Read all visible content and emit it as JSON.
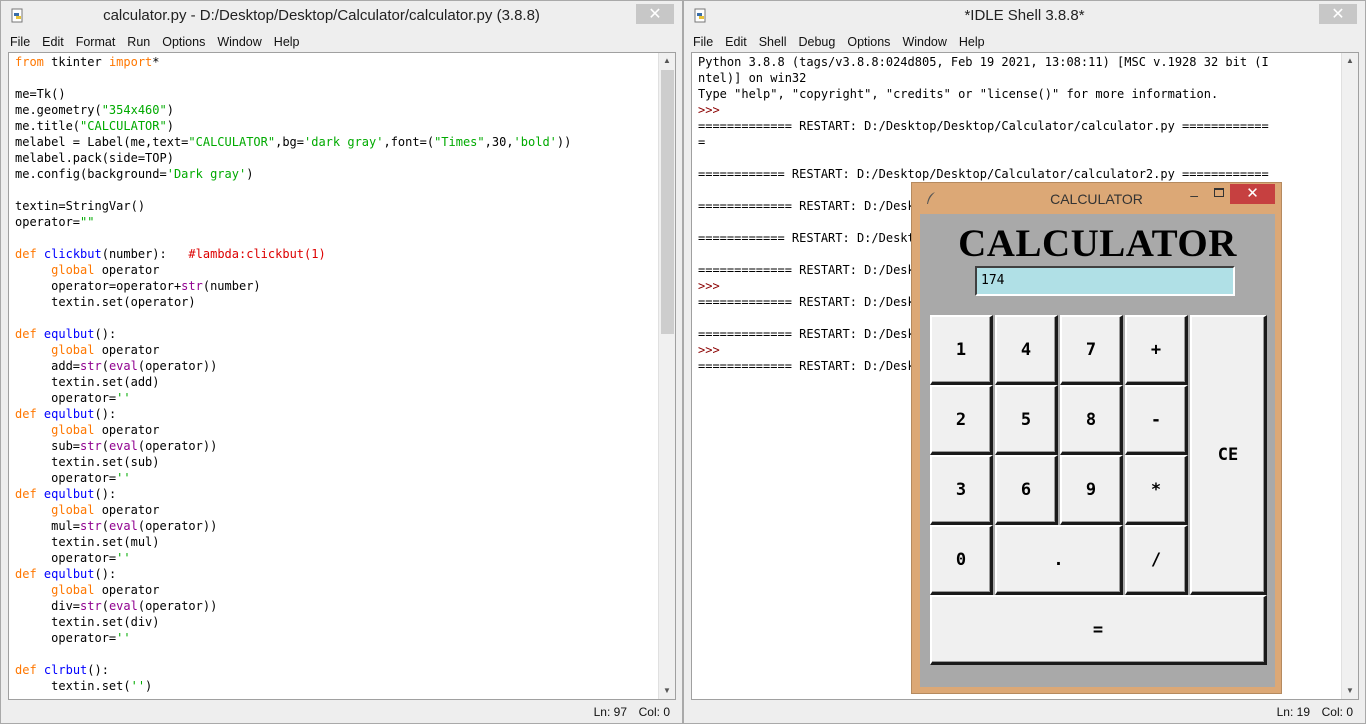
{
  "editor": {
    "title": "calculator.py - D:/Desktop/Desktop/Calculator/calculator.py (3.8.8)",
    "menu": [
      "File",
      "Edit",
      "Format",
      "Run",
      "Options",
      "Window",
      "Help"
    ],
    "status": {
      "line": "Ln: 97",
      "col": "Col: 0"
    },
    "code_lines": [
      [
        [
          "kw",
          "from"
        ],
        [
          "n",
          " tkinter "
        ],
        [
          "kw",
          "import"
        ],
        [
          "n",
          "*"
        ]
      ],
      [
        [
          "n",
          ""
        ]
      ],
      [
        [
          "n",
          "me=Tk()"
        ]
      ],
      [
        [
          "n",
          "me.geometry("
        ],
        [
          "str",
          "\"354x460\""
        ],
        [
          "n",
          ")"
        ]
      ],
      [
        [
          "n",
          "me.title("
        ],
        [
          "str",
          "\"CALCULATOR\""
        ],
        [
          "n",
          ")"
        ]
      ],
      [
        [
          "n",
          "melabel = Label(me,text="
        ],
        [
          "str",
          "\"CALCULATOR\""
        ],
        [
          "n",
          ",bg="
        ],
        [
          "str",
          "'dark gray'"
        ],
        [
          "n",
          ",font=("
        ],
        [
          "str",
          "\"Times\""
        ],
        [
          "n",
          ",30,"
        ],
        [
          "str",
          "'bold'"
        ],
        [
          "n",
          "))"
        ]
      ],
      [
        [
          "n",
          "melabel.pack(side=TOP)"
        ]
      ],
      [
        [
          "n",
          "me.config(background="
        ],
        [
          "str",
          "'Dark gray'"
        ],
        [
          "n",
          ")"
        ]
      ],
      [
        [
          "n",
          ""
        ]
      ],
      [
        [
          "n",
          "textin=StringVar()"
        ]
      ],
      [
        [
          "n",
          "operator="
        ],
        [
          "str",
          "\"\""
        ]
      ],
      [
        [
          "n",
          ""
        ]
      ],
      [
        [
          "kw",
          "def"
        ],
        [
          "n",
          " "
        ],
        [
          "def",
          "clickbut"
        ],
        [
          "n",
          "(number):   "
        ],
        [
          "cmt",
          "#lambda:clickbut(1)"
        ]
      ],
      [
        [
          "n",
          "     "
        ],
        [
          "kw",
          "global"
        ],
        [
          "n",
          " operator"
        ]
      ],
      [
        [
          "n",
          "     operator=operator+"
        ],
        [
          "bi",
          "str"
        ],
        [
          "n",
          "(number)"
        ]
      ],
      [
        [
          "n",
          "     textin.set(operator)"
        ]
      ],
      [
        [
          "n",
          ""
        ]
      ],
      [
        [
          "kw",
          "def"
        ],
        [
          "n",
          " "
        ],
        [
          "def",
          "equlbut"
        ],
        [
          "n",
          "():"
        ]
      ],
      [
        [
          "n",
          "     "
        ],
        [
          "kw",
          "global"
        ],
        [
          "n",
          " operator"
        ]
      ],
      [
        [
          "n",
          "     add="
        ],
        [
          "bi",
          "str"
        ],
        [
          "n",
          "("
        ],
        [
          "bi",
          "eval"
        ],
        [
          "n",
          "(operator))"
        ]
      ],
      [
        [
          "n",
          "     textin.set(add)"
        ]
      ],
      [
        [
          "n",
          "     operator="
        ],
        [
          "str",
          "''"
        ]
      ],
      [
        [
          "kw",
          "def"
        ],
        [
          "n",
          " "
        ],
        [
          "def",
          "equlbut"
        ],
        [
          "n",
          "():"
        ]
      ],
      [
        [
          "n",
          "     "
        ],
        [
          "kw",
          "global"
        ],
        [
          "n",
          " operator"
        ]
      ],
      [
        [
          "n",
          "     sub="
        ],
        [
          "bi",
          "str"
        ],
        [
          "n",
          "("
        ],
        [
          "bi",
          "eval"
        ],
        [
          "n",
          "(operator))"
        ]
      ],
      [
        [
          "n",
          "     textin.set(sub)"
        ]
      ],
      [
        [
          "n",
          "     operator="
        ],
        [
          "str",
          "''"
        ]
      ],
      [
        [
          "kw",
          "def"
        ],
        [
          "n",
          " "
        ],
        [
          "def",
          "equlbut"
        ],
        [
          "n",
          "():"
        ]
      ],
      [
        [
          "n",
          "     "
        ],
        [
          "kw",
          "global"
        ],
        [
          "n",
          " operator"
        ]
      ],
      [
        [
          "n",
          "     mul="
        ],
        [
          "bi",
          "str"
        ],
        [
          "n",
          "("
        ],
        [
          "bi",
          "eval"
        ],
        [
          "n",
          "(operator))"
        ]
      ],
      [
        [
          "n",
          "     textin.set(mul)"
        ]
      ],
      [
        [
          "n",
          "     operator="
        ],
        [
          "str",
          "''"
        ]
      ],
      [
        [
          "kw",
          "def"
        ],
        [
          "n",
          " "
        ],
        [
          "def",
          "equlbut"
        ],
        [
          "n",
          "():"
        ]
      ],
      [
        [
          "n",
          "     "
        ],
        [
          "kw",
          "global"
        ],
        [
          "n",
          " operator"
        ]
      ],
      [
        [
          "n",
          "     div="
        ],
        [
          "bi",
          "str"
        ],
        [
          "n",
          "("
        ],
        [
          "bi",
          "eval"
        ],
        [
          "n",
          "(operator))"
        ]
      ],
      [
        [
          "n",
          "     textin.set(div)"
        ]
      ],
      [
        [
          "n",
          "     operator="
        ],
        [
          "str",
          "''"
        ]
      ],
      [
        [
          "n",
          ""
        ]
      ],
      [
        [
          "kw",
          "def"
        ],
        [
          "n",
          " "
        ],
        [
          "def",
          "clrbut"
        ],
        [
          "n",
          "():"
        ]
      ],
      [
        [
          "n",
          "     textin.set("
        ],
        [
          "str",
          "''"
        ],
        [
          "n",
          ")"
        ]
      ]
    ]
  },
  "shell": {
    "title": "*IDLE Shell 3.8.8*",
    "menu": [
      "File",
      "Edit",
      "Shell",
      "Debug",
      "Options",
      "Window",
      "Help"
    ],
    "status": {
      "line": "Ln: 19",
      "col": "Col: 0"
    },
    "lines": [
      [
        [
          "cons",
          "Python 3.8.8 (tags/v3.8.8:024d805, Feb 19 2021, 13:08:11) [MSC v.1928 32 bit (I"
        ]
      ],
      [
        [
          "cons",
          "ntel)] on win32"
        ]
      ],
      [
        [
          "cons",
          "Type \"help\", \"copyright\", \"credits\" or \"license()\" for more information."
        ]
      ],
      [
        [
          "prompt",
          ">>> "
        ]
      ],
      [
        [
          "cons",
          "============= RESTART: D:/Desktop/Desktop/Calculator/calculator.py ============"
        ]
      ],
      [
        [
          "cons",
          "="
        ]
      ],
      [
        [
          "cons",
          ""
        ]
      ],
      [
        [
          "cons",
          "============ RESTART: D:/Desktop/Desktop/Calculator/calculator2.py ============"
        ]
      ],
      [
        [
          "cons",
          ""
        ]
      ],
      [
        [
          "cons",
          "============= RESTART: D:/Desktop/Desktop/Calculator/calculator.py ============="
        ]
      ],
      [
        [
          "cons",
          ""
        ]
      ],
      [
        [
          "cons",
          "============ RESTART: D:/Desktop/Desktop/Calculator/calculator2.py ============"
        ]
      ],
      [
        [
          "cons",
          ""
        ]
      ],
      [
        [
          "cons",
          "============= RESTART: D:/Desktop/Desktop/Calculator/calculator.py ============="
        ]
      ],
      [
        [
          "prompt",
          ">>> "
        ]
      ],
      [
        [
          "cons",
          "============= RESTART: D:/Desktop/Desktop/Calculator/calculator.py ============="
        ]
      ],
      [
        [
          "cons",
          ""
        ]
      ],
      [
        [
          "cons",
          "============= RESTART: D:/Desktop/Desktop/Calculator/calculator.py ============="
        ]
      ],
      [
        [
          "prompt",
          ">>> "
        ]
      ],
      [
        [
          "cons",
          "============= RESTART: D:/Desktop/Desktop/Calculator/calculator.py ============="
        ]
      ]
    ]
  },
  "calculator": {
    "window_title": "CALCULATOR",
    "heading": "CALCULATOR",
    "display_value": "174",
    "buttons": {
      "b1": "1",
      "b4": "4",
      "b7": "7",
      "plus": "+",
      "b2": "2",
      "b5": "5",
      "b8": "8",
      "minus": "-",
      "b3": "3",
      "b6": "6",
      "b9": "9",
      "mul": "*",
      "b0": "0",
      "dot": ".",
      "div": "/",
      "ce": "CE",
      "eq": "="
    },
    "colors": {
      "frame": "#dca876",
      "client": "#a9a9a9",
      "entry": "#b0e0e6",
      "close": "#c64040"
    }
  }
}
